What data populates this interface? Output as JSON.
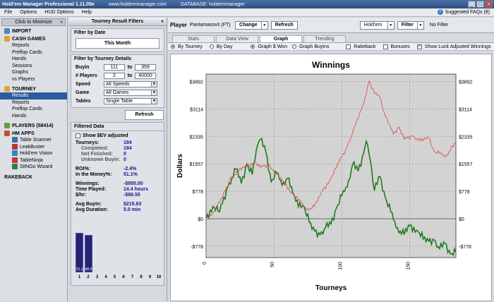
{
  "titlebar": {
    "app": "Hold'em Manager Professional 1.11.05e",
    "site": "www.holdemmanager.com",
    "database": "DATABASE: holdemmanager"
  },
  "menu": {
    "items": [
      "File",
      "Options",
      "HUD Options",
      "Help"
    ],
    "faq": "Suggested FAQs (8)"
  },
  "sidebar": {
    "minimize": "Click to Minimize",
    "import": "IMPORT",
    "cash_games": "CASH GAMES",
    "cash_items": [
      "Reports",
      "Preflop Cards",
      "Hands",
      "Sessions",
      "Graphs",
      "vs Players"
    ],
    "tourney": "TOURNEY",
    "tourney_items": [
      "Results",
      "Reports",
      "Preflop Cards",
      "Hands"
    ],
    "players": "PLAYERS (58414)",
    "hm_apps": "HM APPS",
    "apps": [
      "Table Scanner",
      "LeakBuster",
      "Hold'em Vision",
      "TableNinja",
      "SitNGo Wizard"
    ],
    "rakeback": "RAKEBACK",
    "colors": {
      "selected": "#2c5aa0"
    }
  },
  "filters": {
    "title": "Tourney Result Filters",
    "by_date": "Filter by Date",
    "date_value": "This Month",
    "by_details": "Filter by Tourney Details",
    "buyin_label": "Buyin",
    "buyin_min": "111",
    "to": "to",
    "buyin_max": "359",
    "players_label": "# Players",
    "players_min": "2",
    "players_max": "40000",
    "speed_label": "Speed",
    "speed_value": "All Speeds",
    "game_label": "Game",
    "game_value": "All Games",
    "tables_label": "Tables",
    "tables_value": "Single Table",
    "refresh": "Refresh"
  },
  "filtered": {
    "title": "Filtered Data",
    "ev_label": "Show $EV adjusted",
    "tourneys_k": "Tourneys:",
    "tourneys_v": "184",
    "completed_k": "Completed:",
    "completed_v": "184",
    "notfinished_k": "Not Finished:",
    "notfinished_v": "0",
    "unknown_k": "Unknown Buyin:",
    "unknown_v": "0",
    "roi_k": "ROI%:",
    "roi_v": "-2.4%",
    "itm_k": "In the Money%:",
    "itm_v": "51.1%",
    "winnings_k": "Winnings:",
    "winnings_v": "-$955.00",
    "time_k": "Time Played:",
    "time_v": "14.4 hours",
    "hr_k": "$/hr:",
    "hr_v": "-$66.55",
    "avgbuyin_k": "Avg Buyin:",
    "avgbuyin_v": "$215.63",
    "avgdur_k": "Avg Duration:",
    "avgdur_v": "5.0 min",
    "hist": {
      "labels": [
        "1",
        "2",
        "3",
        "4",
        "5",
        "6",
        "7",
        "8",
        "9",
        "10"
      ],
      "values": [
        51.1,
        48.9,
        0,
        0,
        0,
        0,
        0,
        0,
        0,
        0
      ],
      "bar_texts": [
        "51.1",
        "48.9"
      ]
    }
  },
  "main": {
    "player_label": "Player",
    "player_name": "Pantamasovš (FT)",
    "change": "Change",
    "refresh": "Refresh",
    "game": "Hold'em",
    "filter": "Filter",
    "nofilter": "No Filter",
    "tabs": [
      "Stats",
      "Data View",
      "Graph",
      "Trending"
    ],
    "opt_bytourney": "By Tourney",
    "opt_byday": "By Day",
    "opt_graphwon": "Graph $ Won",
    "opt_graphbuyins": "Graph Buyins",
    "opt_rakeback": "Rakeback",
    "opt_bonuses": "Bonuses",
    "opt_luck": "Show Luck Adjusted Winnings"
  },
  "chart_data": {
    "type": "line",
    "title": "Winnings",
    "xlabel": "Tourneys",
    "ylabel": "Dollars",
    "yticks": [
      "$3892",
      "$3114",
      "$2335",
      "$1557",
      "$778",
      "$0",
      "-$778"
    ],
    "ytick_values": [
      3892,
      3114,
      2335,
      1557,
      778,
      0,
      -778
    ],
    "xticks": [
      "0",
      "50",
      "100",
      "150"
    ],
    "xtick_values": [
      0,
      50,
      100,
      150
    ],
    "xlim": [
      0,
      184
    ],
    "ylim": [
      -1100,
      4100
    ],
    "grid": true,
    "series": [
      {
        "color": "#1f7a1f",
        "points": [
          [
            0,
            0
          ],
          [
            5,
            350
          ],
          [
            10,
            200
          ],
          [
            16,
            900
          ],
          [
            22,
            1400
          ],
          [
            26,
            1000
          ],
          [
            30,
            1550
          ],
          [
            34,
            1250
          ],
          [
            38,
            2100
          ],
          [
            40,
            2250
          ],
          [
            44,
            1900
          ],
          [
            48,
            1050
          ],
          [
            52,
            1300
          ],
          [
            56,
            950
          ],
          [
            60,
            1150
          ],
          [
            66,
            500
          ],
          [
            72,
            350
          ],
          [
            78,
            -300
          ],
          [
            84,
            -450
          ],
          [
            88,
            -250
          ],
          [
            92,
            -150
          ],
          [
            96,
            300
          ],
          [
            100,
            650
          ],
          [
            104,
            900
          ],
          [
            108,
            1550
          ],
          [
            112,
            1350
          ],
          [
            116,
            1850
          ],
          [
            118,
            2200
          ],
          [
            121,
            1650
          ],
          [
            124,
            800
          ],
          [
            128,
            1200
          ],
          [
            132,
            600
          ],
          [
            136,
            200
          ],
          [
            140,
            -250
          ],
          [
            146,
            -450
          ],
          [
            150,
            -200
          ],
          [
            156,
            -350
          ],
          [
            162,
            -650
          ],
          [
            168,
            -600
          ],
          [
            172,
            -850
          ],
          [
            176,
            -700
          ],
          [
            180,
            -1000
          ],
          [
            184,
            -955
          ]
        ]
      },
      {
        "color": "#e05050",
        "points": [
          [
            0,
            0
          ],
          [
            6,
            200
          ],
          [
            12,
            600
          ],
          [
            18,
            1150
          ],
          [
            24,
            1350
          ],
          [
            30,
            1500
          ],
          [
            36,
            1600
          ],
          [
            40,
            1450
          ],
          [
            46,
            1550
          ],
          [
            52,
            1250
          ],
          [
            58,
            1000
          ],
          [
            64,
            700
          ],
          [
            70,
            450
          ],
          [
            74,
            250
          ],
          [
            80,
            350
          ],
          [
            86,
            800
          ],
          [
            92,
            1150
          ],
          [
            98,
            1600
          ],
          [
            104,
            2050
          ],
          [
            110,
            2650
          ],
          [
            116,
            3250
          ],
          [
            120,
            3900
          ],
          [
            124,
            3550
          ],
          [
            128,
            3450
          ],
          [
            132,
            2900
          ],
          [
            138,
            2400
          ],
          [
            142,
            2600
          ],
          [
            146,
            2250
          ],
          [
            152,
            2350
          ],
          [
            158,
            2200
          ],
          [
            164,
            2300
          ],
          [
            168,
            1900
          ],
          [
            172,
            1850
          ],
          [
            176,
            1750
          ],
          [
            180,
            1950
          ],
          [
            184,
            2150
          ]
        ]
      }
    ]
  }
}
